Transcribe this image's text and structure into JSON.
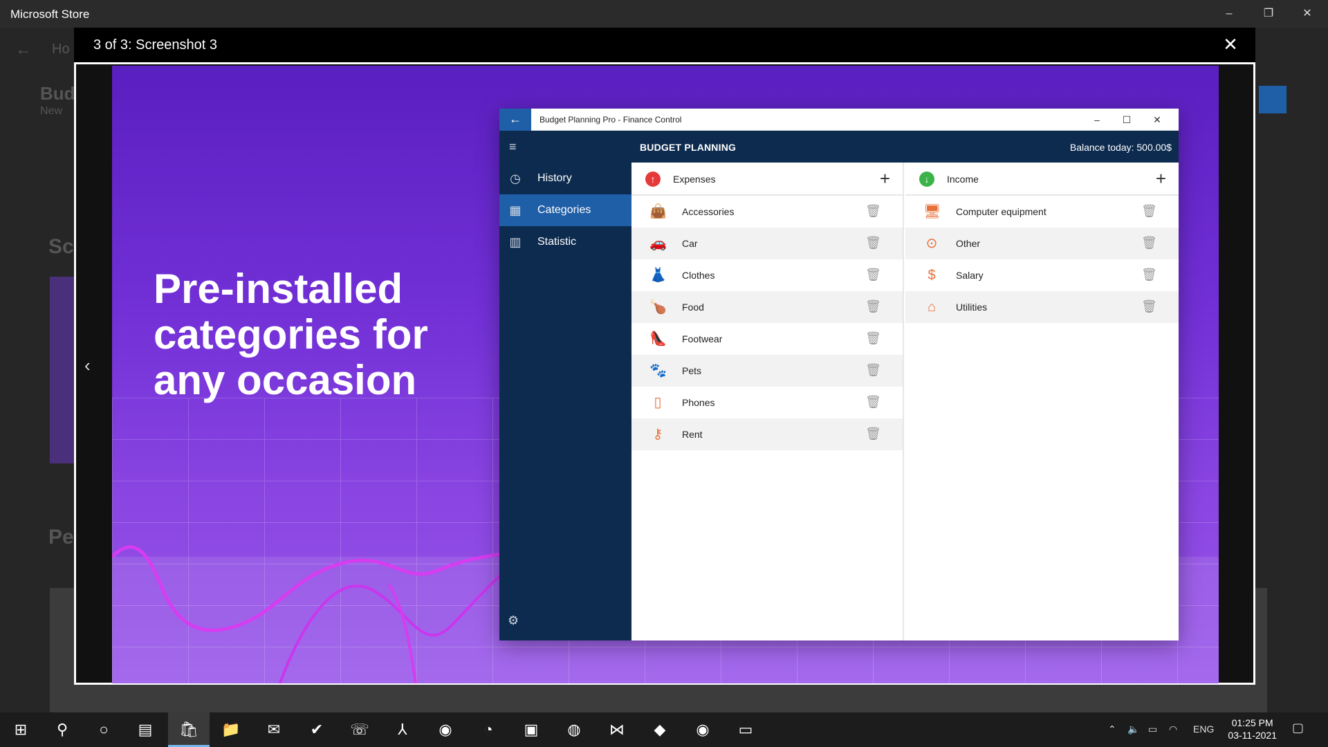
{
  "store": {
    "title": "Microsoft Store",
    "minimize": "–",
    "restore": "❐",
    "close": "✕",
    "bg_title": "Bud",
    "bg_sub": "New",
    "bg_section1": "Sc",
    "bg_section2": "Pe",
    "bg_tab": "Ho"
  },
  "lightbox": {
    "title": "3 of 3: Screenshot 3",
    "close": "✕",
    "prev": "‹"
  },
  "screenshot": {
    "headline": "Pre-installed categories for any occasion"
  },
  "app": {
    "window_title": "Budget Planning Pro - Finance Control",
    "heading": "BUDGET PLANNING",
    "balance": "Balance today:  500.00$",
    "nav": [
      {
        "label": "History",
        "icon": "history-icon"
      },
      {
        "label": "Categories",
        "icon": "categories-icon"
      },
      {
        "label": "Statistic",
        "icon": "statistic-icon"
      }
    ],
    "expenses": {
      "title": "Expenses",
      "color": "#e63a3a",
      "items": [
        "Accessories",
        "Car",
        "Clothes",
        "Food",
        "Footwear",
        "Pets",
        "Phones",
        "Rent"
      ]
    },
    "income": {
      "title": "Income",
      "color": "#3bb34a",
      "items": [
        "Computer equipment",
        "Other",
        "Salary",
        "Utilities"
      ]
    }
  },
  "taskbar": {
    "language": "ENG",
    "time": "01:25 PM",
    "date": "03-11-2021"
  }
}
